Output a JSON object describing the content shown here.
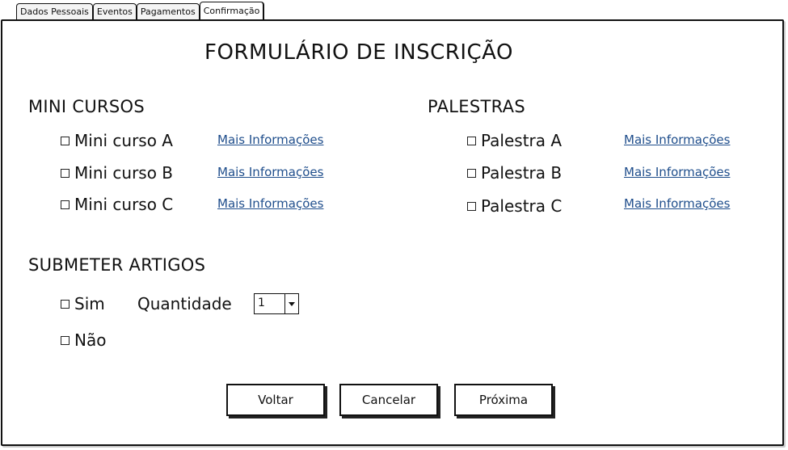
{
  "tabs": [
    {
      "label": "Dados Pessoais"
    },
    {
      "label": "Eventos"
    },
    {
      "label": "Pagamentos"
    },
    {
      "label": "Confirmação"
    }
  ],
  "form": {
    "title": "FORMULÁRIO DE INSCRIÇÃO"
  },
  "mini_cursos": {
    "heading": "MINI CURSOS",
    "items": [
      {
        "label": "Mini curso A",
        "link": "Mais Informações"
      },
      {
        "label": "Mini curso B",
        "link": "Mais Informações"
      },
      {
        "label": "Mini curso C",
        "link": "Mais Informações"
      }
    ]
  },
  "palestras": {
    "heading": "PALESTRAS",
    "items": [
      {
        "label": "Palestra A",
        "link": "Mais Informações"
      },
      {
        "label": "Palestra B",
        "link": "Mais Informações"
      },
      {
        "label": "Palestra C",
        "link": "Mais Informações"
      }
    ]
  },
  "artigos": {
    "heading": "SUBMETER ARTIGOS",
    "sim_label": "Sim",
    "nao_label": "Não",
    "quantity_label": "Quantidade",
    "quantity_value": "1"
  },
  "buttons": {
    "back": "Voltar",
    "cancel": "Cancelar",
    "next": "Próxima"
  },
  "colors": {
    "link": "#1f4e8c"
  }
}
